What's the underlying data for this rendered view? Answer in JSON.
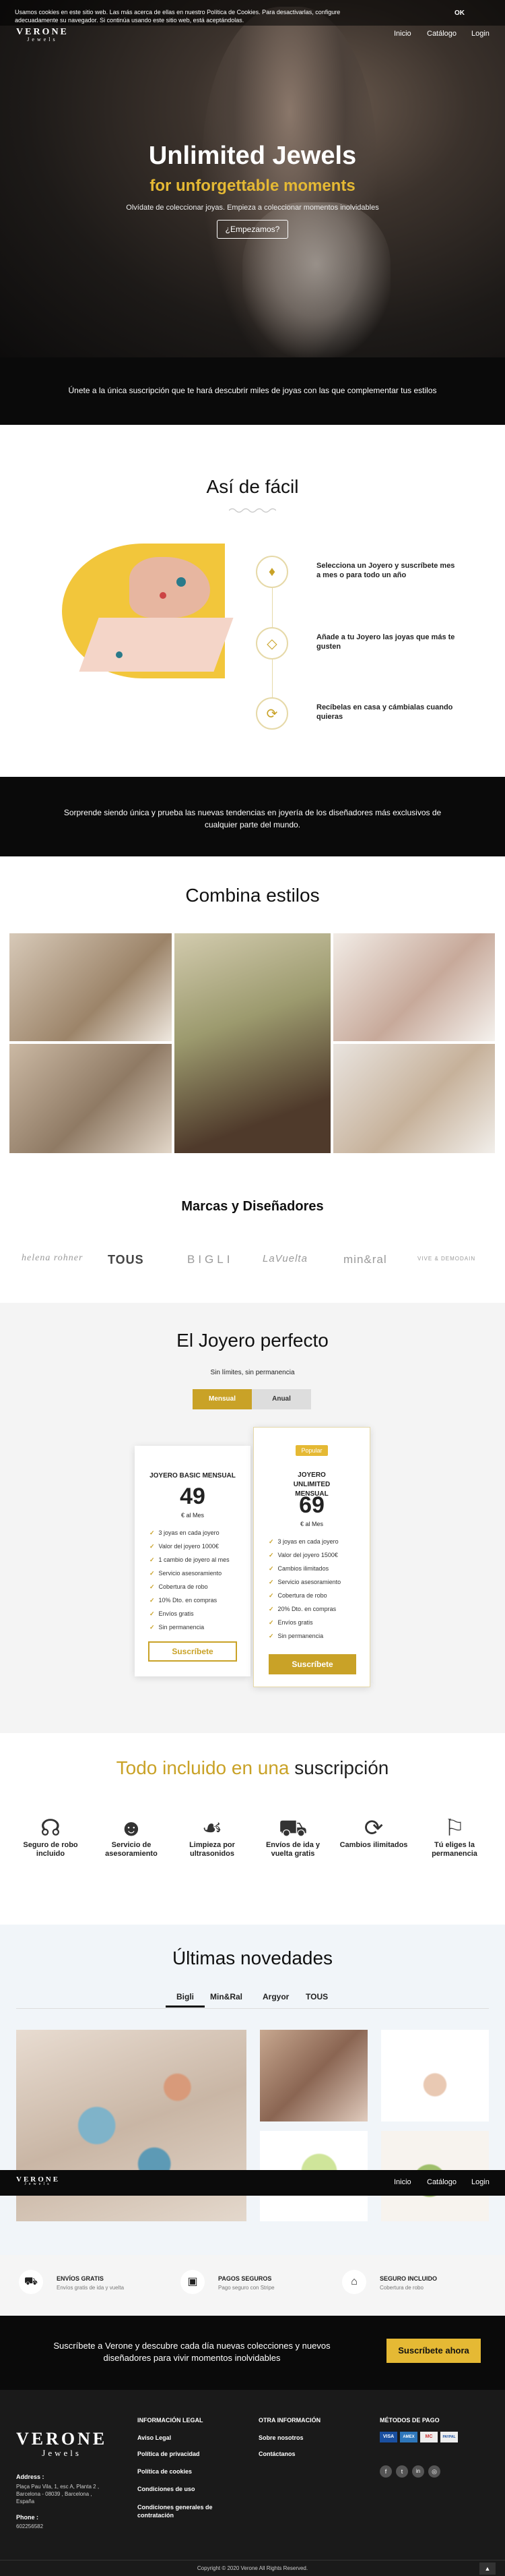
{
  "cookie": {
    "text": "Usamos cookies en este sitio web. Las más acerca de ellas en nuestro Política de Cookies. Para desactivarlas, configure adecuadamente su navegador. Si continúa usando este sitio web, está aceptándolas.",
    "ok": "OK"
  },
  "header": {
    "logo_main": "VERONE",
    "logo_sub": "Jewels",
    "nav": [
      "Inicio",
      "Catálogo",
      "Login"
    ]
  },
  "hero": {
    "title": "Unlimited Jewels",
    "subtitle": "for unforgettable moments",
    "tagline": "Olvídate de coleccionar joyas. Empieza a coleccionar momentos inolvidables",
    "cta": "¿Empezamos?"
  },
  "band1": {
    "text": "Únete a la única suscripción que te hará descubrir miles de joyas con las que complementar tus estilos"
  },
  "how": {
    "title": "Así de fácil",
    "steps": [
      "Selecciona un Joyero y suscríbete mes a mes o para todo un año",
      "Añade a tu Joyero las joyas que más te gusten",
      "Recíbelas en casa y cámbialas cuando quieras"
    ]
  },
  "band2": {
    "text": "Sorprende siendo única y prueba las nuevas tendencias en joyería de los diseñadores más exclusivos de cualquier parte del mundo."
  },
  "styles": {
    "title": "Combina estilos"
  },
  "brands": {
    "title": "Marcas y Diseñadores",
    "items": [
      "helena rohner",
      "TOUS",
      "BIGLI",
      "LaVuelta",
      "min&ral",
      "VIVE & DEMODAIN"
    ]
  },
  "pricing": {
    "title": "El Joyero perfecto",
    "subtitle": "Sin límites, sin permanencia",
    "toggle": [
      "Mensual",
      "Anual"
    ],
    "basic": {
      "name": "JOYERO BASIC MENSUAL",
      "price": "49",
      "period": "€ al Mes",
      "features": [
        "3 joyas en cada joyero",
        "Valor del joyero 1000€",
        "1 cambio de joyero al mes",
        "Servicio asesoramiento",
        "Cobertura de robo",
        "10% Dto. en compras",
        "Envíos gratis",
        "Sin permanencia"
      ],
      "cta": "Suscríbete"
    },
    "unlimited": {
      "badge": "Popular",
      "name": "JOYERO UNLIMITED MENSUAL",
      "price": "69",
      "period": "€ al Mes",
      "features": [
        "3 joyas en cada joyero",
        "Valor del joyero 1500€",
        "Cambios ilimitados",
        "Servicio asesoramiento",
        "Cobertura de robo",
        "20% Dto. en compras",
        "Envíos gratis",
        "Sin permanencia"
      ],
      "cta": "Suscríbete"
    }
  },
  "included": {
    "title_a": "Todo incluido en una",
    "title_b": "suscripción",
    "items": [
      {
        "label": "Seguro de robo incluido",
        "icon": "runner-icon"
      },
      {
        "label": "Servicio de asesoramiento",
        "icon": "advisor-icon"
      },
      {
        "label": "Limpieza por ultrasonidos",
        "icon": "cleaning-icon"
      },
      {
        "label": "Envíos de ida y vuelta gratis",
        "icon": "truck-icon"
      },
      {
        "label": "Cambios ilimitados",
        "icon": "exchange-icon"
      },
      {
        "label": "Tú eliges la permanencia",
        "icon": "choice-icon"
      }
    ]
  },
  "latest": {
    "title": "Últimas novedades",
    "tabs": [
      "Bigli",
      "Min&Ral",
      "Argyor",
      "TOUS"
    ]
  },
  "benefits": [
    {
      "title": "ENVÍOS GRATIS",
      "text": "Envíos gratis de ida y vuelta"
    },
    {
      "title": "PAGOS SEGUROS",
      "text": "Pago seguro con Stripe"
    },
    {
      "title": "SEGURO INCLUIDO",
      "text": "Cobertura de robo"
    }
  ],
  "cta_band": {
    "text": "Suscríbete a Verone y descubre cada día nuevas colecciones y nuevos diseñadores para vivir momentos inolvidables",
    "button": "Suscríbete ahora"
  },
  "footer": {
    "address_label": "Address :",
    "address": "Plaça Pau Vila, 1, esc A, Planta 2 , Barcelona - 08039 , Barcelona , España",
    "phone_label": "Phone :",
    "phone": "602256582",
    "legal_title": "INFORMACIÓN LEGAL",
    "legal_links": [
      "Aviso Legal",
      "Política de privacidad",
      "Política de cookies",
      "Condiciones de uso",
      "Condiciones generales de contratación"
    ],
    "other_title": "OTRA INFORMACIÓN",
    "other_links": [
      "Sobre nosotros",
      "Contáctanos"
    ],
    "pay_title": "MÉTODOS DE PAGO",
    "pay_methods": [
      "VISA",
      "AMEX",
      "MC",
      "PAYPAL"
    ],
    "copyright": "Copyright © 2020 Verone All Rights Reserved."
  }
}
